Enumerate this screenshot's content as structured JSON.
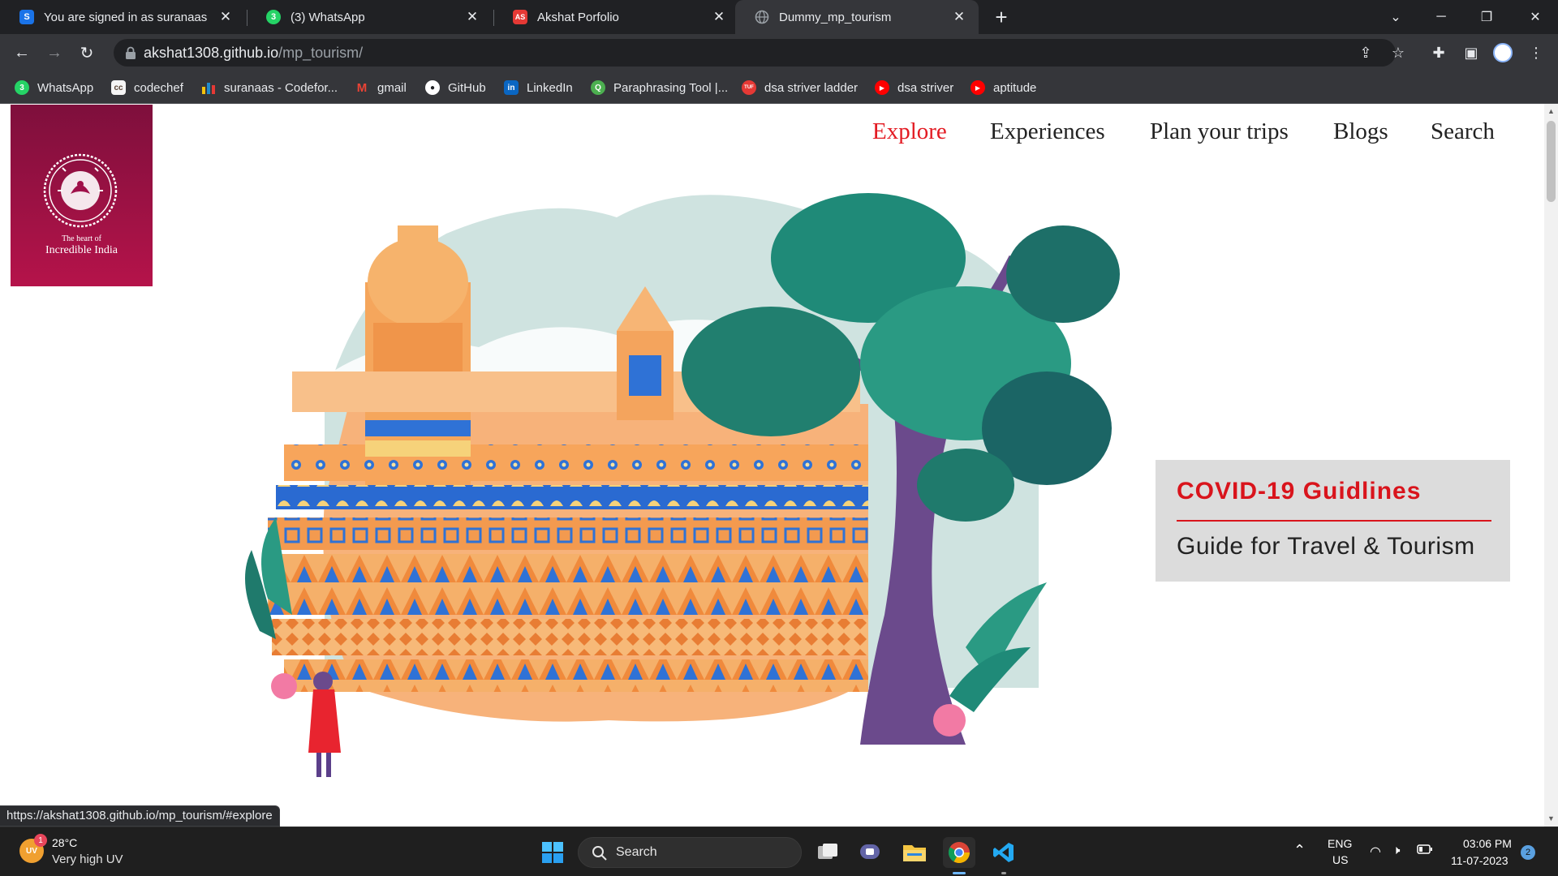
{
  "browser": {
    "tabs": [
      {
        "title": "You are signed in as suranaas",
        "favicon": "S",
        "favicon_color": "#1a73e8",
        "active": false
      },
      {
        "title": "(3) WhatsApp",
        "favicon": "3",
        "favicon_color": "#25d366",
        "active": false
      },
      {
        "title": "Akshat Porfolio",
        "favicon": "AS",
        "favicon_color": "#e53935",
        "active": false
      },
      {
        "title": "Dummy_mp_tourism",
        "favicon": "globe",
        "favicon_color": "#9aa0a6",
        "active": true
      }
    ],
    "url_host": "akshat1308.github.io",
    "url_path": "/mp_tourism/",
    "bookmarks": [
      {
        "label": "WhatsApp",
        "icon": "whatsapp-icon",
        "color": "#25d366",
        "glyph": "3"
      },
      {
        "label": "codechef",
        "icon": "codechef-icon",
        "color": "#5b4638",
        "glyph": "cc"
      },
      {
        "label": "suranaas - Codefor...",
        "icon": "codeforces-icon",
        "color": "#1f8acb",
        "glyph": ""
      },
      {
        "label": "gmail",
        "icon": "gmail-icon",
        "color": "#ea4335",
        "glyph": "M"
      },
      {
        "label": "GitHub",
        "icon": "github-icon",
        "color": "#ffffff",
        "glyph": ""
      },
      {
        "label": "LinkedIn",
        "icon": "linkedin-icon",
        "color": "#0a66c2",
        "glyph": "in"
      },
      {
        "label": "Paraphrasing Tool |...",
        "icon": "quillbot-icon",
        "color": "#4caf50",
        "glyph": "Q"
      },
      {
        "label": "dsa striver ladder",
        "icon": "tuf-icon",
        "color": "#e53935",
        "glyph": "TUF"
      },
      {
        "label": "dsa striver",
        "icon": "youtube-icon",
        "color": "#ff0000",
        "glyph": "▶"
      },
      {
        "label": "aptitude",
        "icon": "youtube-icon",
        "color": "#ff0000",
        "glyph": "▶"
      }
    ],
    "status_url": "https://akshat1308.github.io/mp_tourism/#explore"
  },
  "page": {
    "logo": {
      "emblem_text": "MADHYA PRADESH",
      "tagline_1": "The heart of",
      "tagline_2": "Incredible India",
      "bg_color": "#a0114a"
    },
    "nav": [
      {
        "label": "Explore",
        "active": true
      },
      {
        "label": "Experiences",
        "active": false
      },
      {
        "label": "Plan your trips",
        "active": false
      },
      {
        "label": "Blogs",
        "active": false
      },
      {
        "label": "Search",
        "active": false
      }
    ],
    "accent_color": "#e31b23",
    "covid_card": {
      "title": "COVID-19 Guidlines",
      "subtitle": "Guide for Travel & Tourism"
    }
  },
  "taskbar": {
    "weather": {
      "badge": "1",
      "icon_label": "UV",
      "temp": "28°C",
      "desc": "Very high UV"
    },
    "search_label": "Search",
    "pinned": [
      "task-view-icon",
      "teams-chat-icon",
      "file-explorer-icon",
      "chrome-icon",
      "vscode-icon"
    ],
    "language": {
      "line1": "ENG",
      "line2": "US"
    },
    "time": "03:06 PM",
    "date": "11-07-2023",
    "notification_count": "2"
  }
}
